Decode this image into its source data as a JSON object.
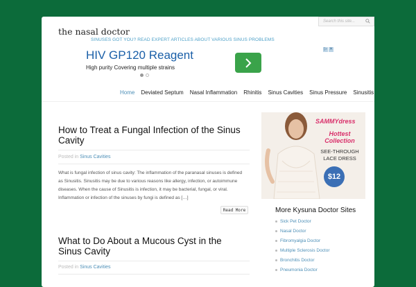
{
  "search": {
    "placeholder": "Search this site..."
  },
  "site": {
    "title": "the nasal doctor",
    "tagline": "SINUSES GOT YOU? READ EXPERT ARTICLES ABOUT VARIOUS SINUS PROBLEMS"
  },
  "ad": {
    "title": "HIV GP120 Reagent",
    "subtitle": "High purity Covering multiple strains"
  },
  "nav": {
    "items": [
      "Home",
      "Deviated Septum",
      "Nasal Inflammation",
      "Rhinitis",
      "Sinus Cavities",
      "Sinus Pressure",
      "Sinusitis"
    ]
  },
  "posts": [
    {
      "title": "How to Treat a Fungal Infection of the Sinus Cavity",
      "posted_in": "Posted in",
      "category": "Sinus Cavities",
      "excerpt": "What is fungal infection of sinus cavity: The inflammation of the paranasal sinuses is defined as Sinusitis. Sinusitis may be due to various reasons like allergy, infection, or autoimmune diseases. When the cause of Sinusitis is infection, it may be bacterial, fungal, or viral. Inflammation or infection of the sinuses by fungi is defined as […]",
      "read_more": "Read More"
    },
    {
      "title": "What to Do About a Mucous Cyst in the Sinus Cavity",
      "posted_in": "Posted in",
      "category": "Sinus Cavities"
    }
  ],
  "side_ad": {
    "brand": "SAMMYdress",
    "line1": "Hottest",
    "line2": "Collection",
    "line3": "SEE-THROUGH",
    "line4": "LACE DRESS",
    "price": "$12"
  },
  "sidebar": {
    "heading": "More Kysuna Doctor Sites",
    "links": [
      "Sick Pet Doctor",
      "Nasal Doctor",
      "Fibromyalgia Doctor",
      "Multiple Sclerosis Doctor",
      "Bronchitis Doctor",
      "Pneumonia Doctor"
    ]
  },
  "colors": {
    "background": "#0c6b3a",
    "link": "#4d8fb7",
    "ad_cta": "#3aa34a",
    "ad_title": "#1a5fa8",
    "side_ad_accent": "#d9306b"
  }
}
